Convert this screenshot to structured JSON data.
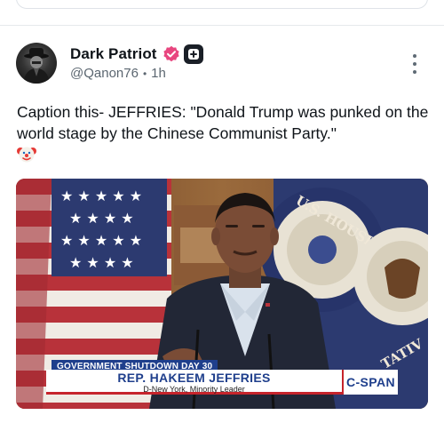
{
  "post": {
    "display_name": "Dark Patriot",
    "handle": "@Qanon76",
    "separator": "•",
    "time": "1h",
    "text": "Caption this- JEFFRIES: \"Donald Trump was punked on the world stage by the Chinese Communist Party.\"",
    "emoji": "clown-face-icon"
  },
  "media": {
    "tag": "GOVERNMENT SHUTDOWN DAY 30",
    "name": "REP. HAKEEM JEFFRIES",
    "subtitle": "D-New York, Minority Leader",
    "network": "C-SPAN",
    "seal_text": "U.S. HOUSE OF REPRESENTATIVES"
  },
  "colors": {
    "verified": "#e8467f",
    "badge": "#1a1f27",
    "cspan_blue": "#1f3f8c",
    "cspan_red": "#c6242b",
    "muted_text": "#5b6670"
  }
}
